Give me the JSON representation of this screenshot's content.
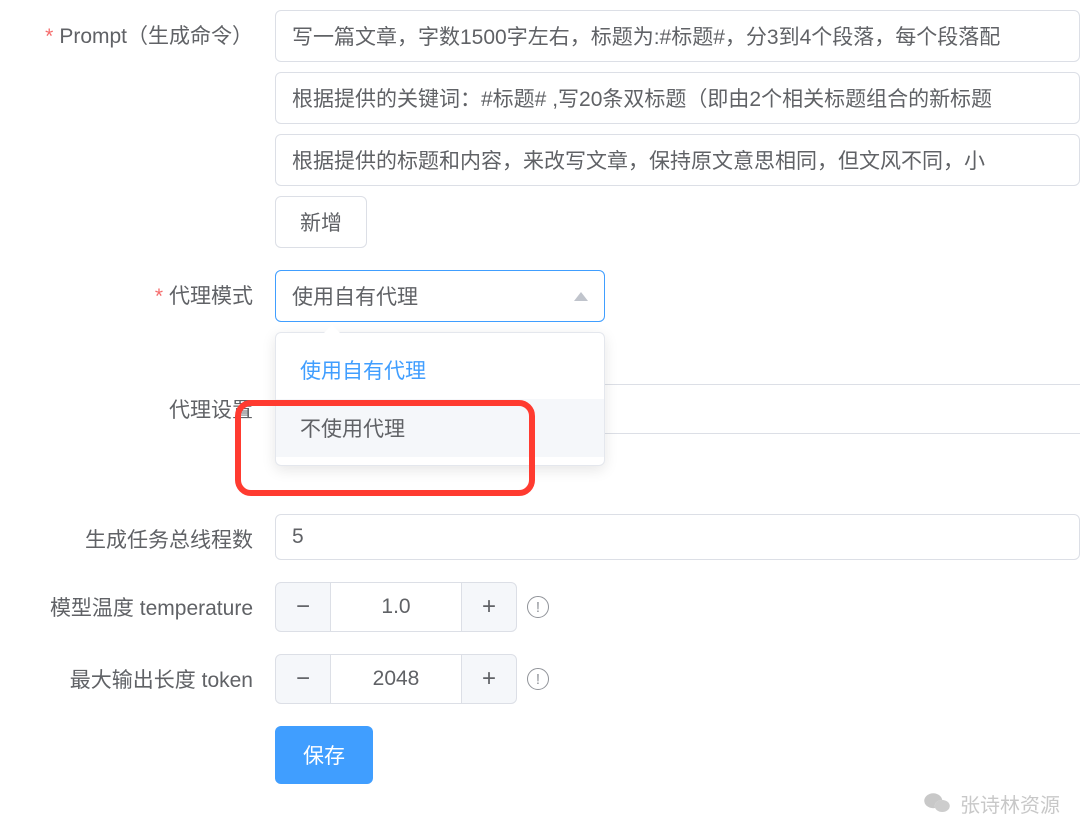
{
  "form": {
    "prompt": {
      "label": "Prompt（生成命令）",
      "items": [
        "写一篇文章，字数1500字左右，标题为:#标题#，分3到4个段落，每个段落配",
        "根据提供的关键词：#标题# ,写20条双标题（即由2个相关标题组合的新标题",
        "根据提供的标题和内容，来改写文章，保持原文意思相同，但文风不同，小"
      ],
      "add_label": "新增"
    },
    "proxy_mode": {
      "label": "代理模式",
      "selected": "使用自有代理",
      "options": [
        {
          "label": "使用自有代理",
          "selected": true
        },
        {
          "label": "不使用代理",
          "selected": false
        }
      ]
    },
    "proxy_setting": {
      "label": "代理设置"
    },
    "threads": {
      "label": "生成任务总线程数",
      "value": "5"
    },
    "temperature": {
      "label": "模型温度 temperature",
      "value": "1.0"
    },
    "max_tokens": {
      "label": "最大输出长度 token",
      "value": "2048"
    },
    "save_label": "保存"
  },
  "watermark": "张诗林资源"
}
